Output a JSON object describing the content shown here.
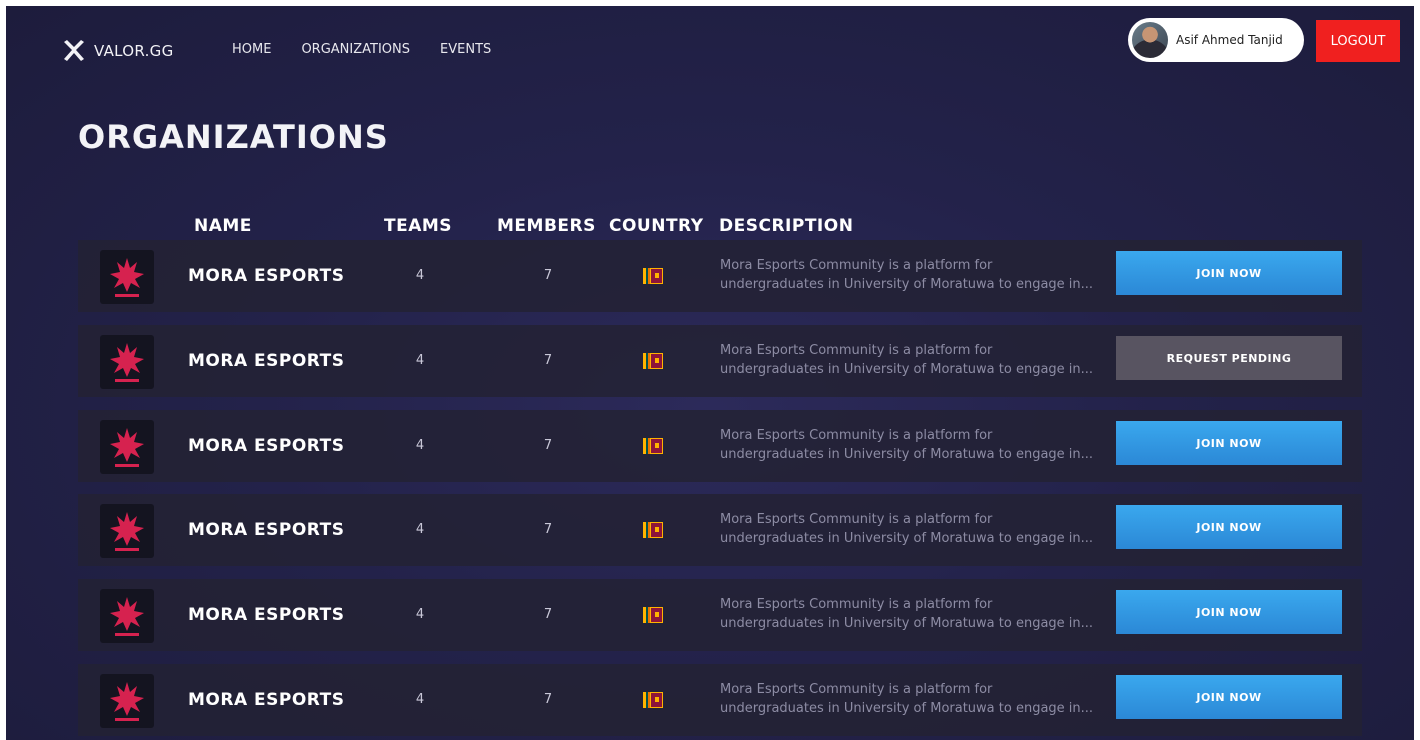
{
  "brand": {
    "icon": "crossed-swords-icon",
    "name": "VALOR.GG"
  },
  "nav": {
    "items": [
      "HOME",
      "ORGANIZATIONS",
      "EVENTS"
    ]
  },
  "user": {
    "name": "Asif Ahmed Tanjid",
    "avatar": "user-avatar"
  },
  "logout_label": "LOGOUT",
  "page_title": "ORGANIZATIONS",
  "table": {
    "headers": {
      "name": "NAME",
      "teams": "TEAMS",
      "members": "MEMBERS",
      "country": "COUNTRY",
      "description": "DESCRIPTION"
    },
    "rows": [
      {
        "logo": "mora-esports-logo",
        "name": "MORA ESPORTS",
        "teams": "4",
        "members": "7",
        "country_flag": "sri-lanka-flag-icon",
        "description": "Mora Esports Community is a platform for undergraduates in University of Moratuwa to engage in...",
        "action": "JOIN NOW",
        "action_type": "join"
      },
      {
        "logo": "mora-esports-logo",
        "name": "MORA ESPORTS",
        "teams": "4",
        "members": "7",
        "country_flag": "sri-lanka-flag-icon",
        "description": "Mora Esports Community is a platform for undergraduates in University of Moratuwa to engage in...",
        "action": "REQUEST PENDING",
        "action_type": "pending"
      },
      {
        "logo": "mora-esports-logo",
        "name": "MORA ESPORTS",
        "teams": "4",
        "members": "7",
        "country_flag": "sri-lanka-flag-icon",
        "description": "Mora Esports Community is a platform for undergraduates in University of Moratuwa to engage in...",
        "action": "JOIN NOW",
        "action_type": "join"
      },
      {
        "logo": "mora-esports-logo",
        "name": "MORA ESPORTS",
        "teams": "4",
        "members": "7",
        "country_flag": "sri-lanka-flag-icon",
        "description": "Mora Esports Community is a platform for undergraduates in University of Moratuwa to engage in...",
        "action": "JOIN NOW",
        "action_type": "join"
      },
      {
        "logo": "mora-esports-logo",
        "name": "MORA ESPORTS",
        "teams": "4",
        "members": "7",
        "country_flag": "sri-lanka-flag-icon",
        "description": "Mora Esports Community is a platform for undergraduates in University of Moratuwa to engage in...",
        "action": "JOIN NOW",
        "action_type": "join"
      },
      {
        "logo": "mora-esports-logo",
        "name": "MORA ESPORTS",
        "teams": "4",
        "members": "7",
        "country_flag": "sri-lanka-flag-icon",
        "description": "Mora Esports Community is a platform for undergraduates in University of Moratuwa to engage in...",
        "action": "JOIN NOW",
        "action_type": "join"
      }
    ]
  },
  "colors": {
    "background": "#23224a",
    "join_button": "#2f95e0",
    "pending_button": "#585461",
    "logout": "#f0201f",
    "logo_accent": "#d6224f"
  }
}
